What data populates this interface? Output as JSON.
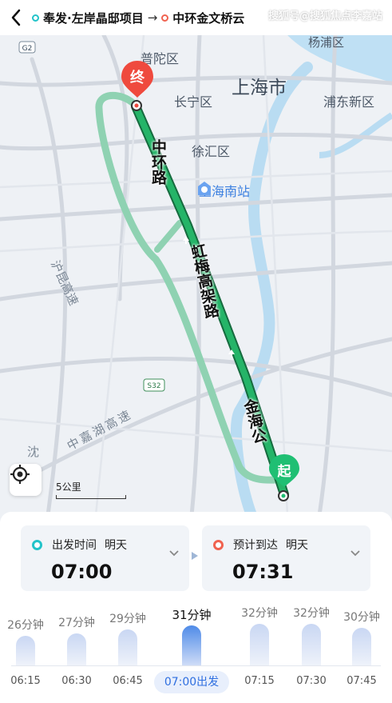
{
  "header": {
    "origin": "奉发·左岸晶邸项目",
    "arrow": "→",
    "destination": "中环金文桥云",
    "watermark": "搜狐号@搜狐焦点李嘉站"
  },
  "map": {
    "districts": [
      "普陀区",
      "长宁区",
      "上海市",
      "浦东新区",
      "徐汇区",
      "杨浦区"
    ],
    "poi": "上海南站",
    "roads": {
      "inner_ring": "中环路",
      "hongmei": "虹梅高架路",
      "jinhai": "金海公",
      "huqingping": "沪昆高速",
      "jiamin": "中嘉湖高速",
      "shen": "沈"
    },
    "road_badges": [
      "G2",
      "S32"
    ],
    "markers": {
      "end": "终",
      "start": "起"
    },
    "scale_label": "5公里",
    "colors": {
      "route_main": "#1fa864",
      "route_alt": "#8fd2b2",
      "start_marker": "#1fbf73",
      "end_marker": "#ef4a3e"
    }
  },
  "departure": {
    "label": "出发时间",
    "day": "明天",
    "time": "07:00"
  },
  "arrival": {
    "label": "预计到达",
    "day": "明天",
    "time": "07:31"
  },
  "timeline": [
    {
      "time": "06:15",
      "duration": "26分钟",
      "minutes": 26,
      "selected": false
    },
    {
      "time": "06:30",
      "duration": "27分钟",
      "minutes": 27,
      "selected": false
    },
    {
      "time": "06:45",
      "duration": "29分钟",
      "minutes": 29,
      "selected": false
    },
    {
      "time": "07:00出发",
      "duration": "31分钟",
      "minutes": 31,
      "selected": true
    },
    {
      "time": "07:15",
      "duration": "32分钟",
      "minutes": 32,
      "selected": false
    },
    {
      "time": "07:30",
      "duration": "32分钟",
      "minutes": 32,
      "selected": false
    },
    {
      "time": "07:45",
      "duration": "30分钟",
      "minutes": 30,
      "selected": false
    }
  ]
}
